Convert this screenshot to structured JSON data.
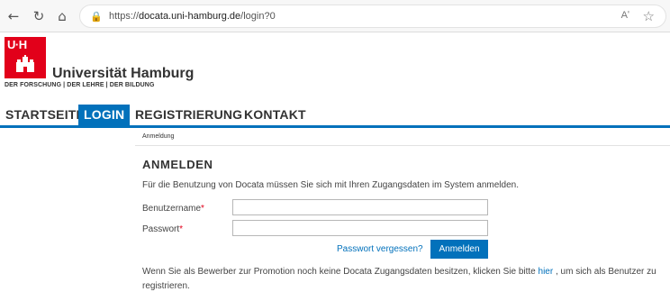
{
  "browser": {
    "url_prefix": "https://",
    "url_host": "docata.uni-hamburg.de",
    "url_path": "/login?0",
    "back_icon": "back-arrow-icon",
    "reload_icon": "reload-icon",
    "home_icon": "home-icon",
    "lock_icon": "lock-icon",
    "read_aloud_label": "Aʹ",
    "favorite_icon": "star-icon"
  },
  "header": {
    "logo_letters": "U·H",
    "university_name": "Universität Hamburg",
    "tagline": "DER FORSCHUNG | DER LEHRE | DER BILDUNG",
    "logo_color": "#e2001a"
  },
  "nav": {
    "items": [
      {
        "label": "STARTSEITE",
        "active": false
      },
      {
        "label": "LOGIN",
        "active": true
      },
      {
        "label": "REGISTRIERUNG",
        "active": false
      },
      {
        "label": "KONTAKT",
        "active": false
      }
    ],
    "accent_color": "#0271bb"
  },
  "content": {
    "breadcrumb": "Anmeldung",
    "title": "ANMELDEN",
    "intro": "Für die Benutzung von Docata müssen Sie sich mit Ihren Zugangsdaten im System anmelden.",
    "username_label": "Benutzername",
    "password_label": "Passwort",
    "required_mark": "*",
    "username_value": "",
    "password_value": "",
    "forgot_password": "Passwort vergessen?",
    "submit_label": "Anmelden",
    "bottom_text_before": "Wenn Sie als Bewerber zur Promotion noch keine Docata Zugangsdaten besitzen, klicken Sie bitte ",
    "bottom_link": "hier",
    "bottom_text_after": " , um sich als Benutzer zu registrieren."
  }
}
